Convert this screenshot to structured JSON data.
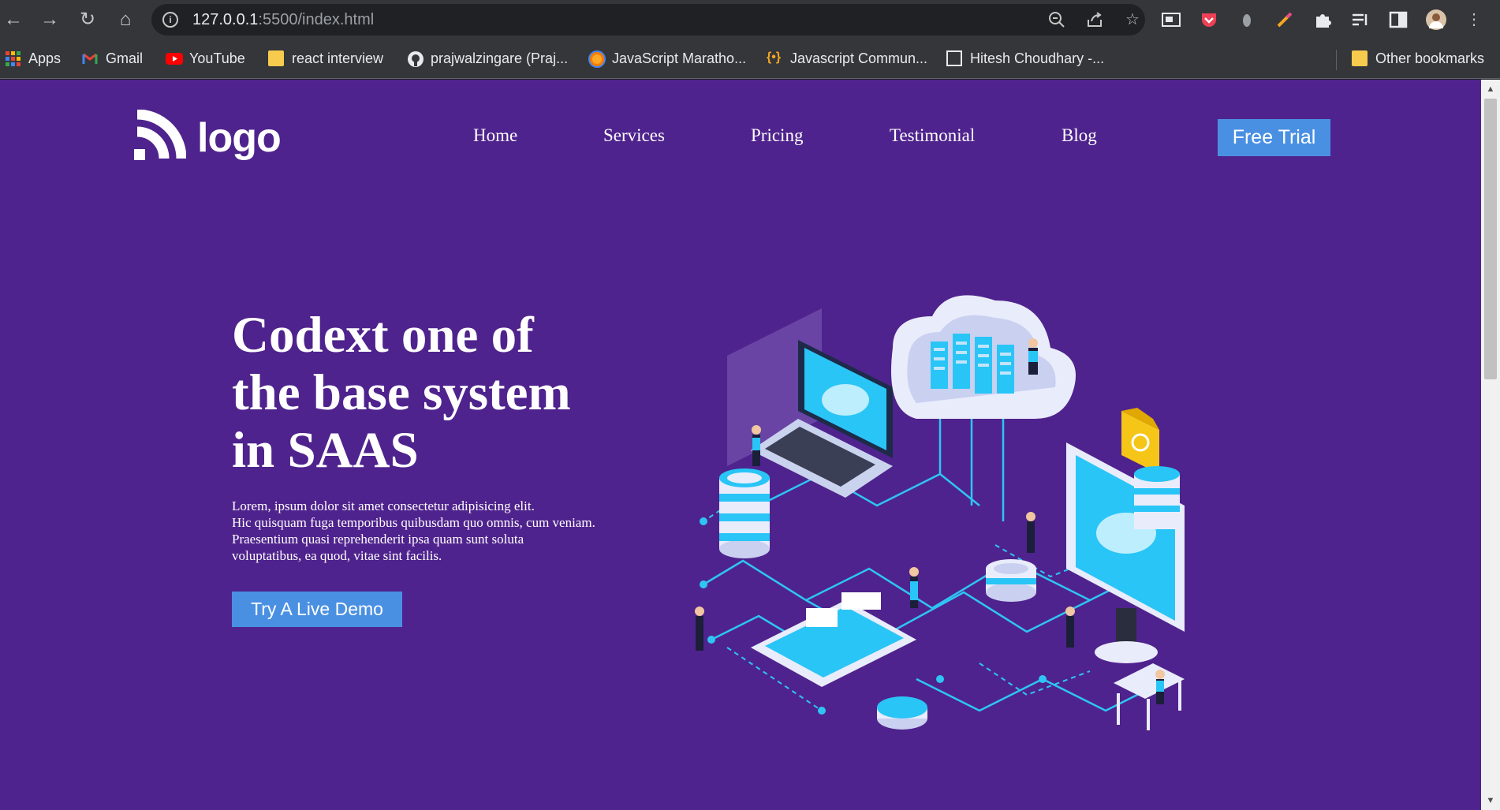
{
  "browser": {
    "url_host": "127.0.0.1",
    "url_path": ":5500/index.html"
  },
  "bookmarks": [
    {
      "label": "Apps",
      "icon": "apps-grid-icon"
    },
    {
      "label": "Gmail",
      "icon": "gmail-icon"
    },
    {
      "label": "YouTube",
      "icon": "youtube-icon"
    },
    {
      "label": "react interview",
      "icon": "folder-icon"
    },
    {
      "label": "prajwalzingare (Praj...",
      "icon": "github-icon"
    },
    {
      "label": "JavaScript Maratho...",
      "icon": "site-icon"
    },
    {
      "label": "Javascript Commun...",
      "icon": "code-braces-icon"
    },
    {
      "label": "Hitesh Choudhary -...",
      "icon": "page-icon"
    },
    {
      "label": "Other bookmarks",
      "icon": "folder-icon"
    }
  ],
  "site": {
    "logo_text": "logo",
    "nav": [
      "Home",
      "Services",
      "Pricing",
      "Testimonial",
      "Blog"
    ],
    "cta_label": "Free Trial",
    "hero": {
      "title_lines": [
        "Codext one of",
        "the base system",
        "in SAAS"
      ],
      "subtitle_lines": [
        "Lorem, ipsum dolor sit amet consectetur adipisicing elit.",
        "Hic quisquam fuga temporibus quibusdam quo omnis, cum veniam.",
        "Praesentium quasi reprehenderit ipsa quam sunt soluta",
        "voluptatibus, ea quod, vitae sint facilis."
      ],
      "button_label": "Try A Live Demo"
    },
    "colors": {
      "background": "#4f238d",
      "accent": "#4a90e2",
      "illustration_cyan": "#29c5f6"
    }
  }
}
